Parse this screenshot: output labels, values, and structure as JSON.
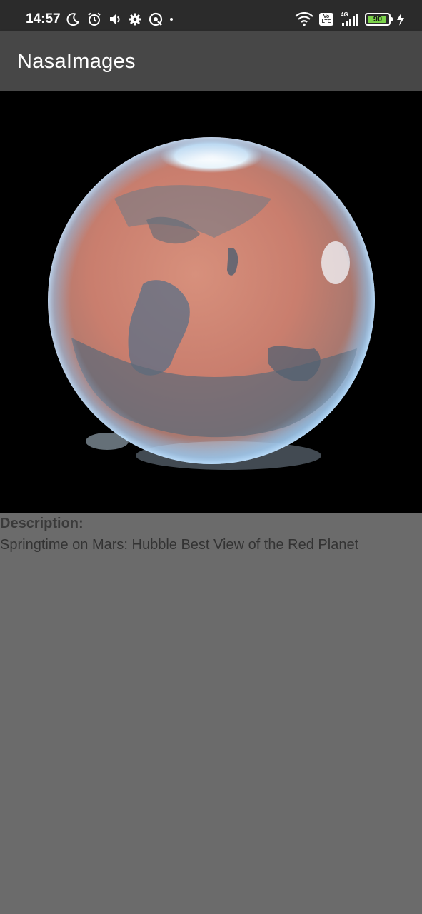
{
  "status_bar": {
    "time": "14:57",
    "left_icons": [
      "moon-icon",
      "alarm-icon",
      "volume-icon",
      "settings-icon",
      "hotspot-icon"
    ],
    "right_icons": [
      "wifi-icon",
      "volte-icon",
      "signal-icon",
      "battery-icon",
      "charging-icon"
    ],
    "volte_label": "Vo LTE",
    "network_type": "4G",
    "battery_level": "90",
    "battery_color": "#7bd24a"
  },
  "app_bar": {
    "title": "NasaImages",
    "background": "#474747"
  },
  "image": {
    "subject": "mars-planet-image"
  },
  "description": {
    "heading": "Description:",
    "text": "Springtime on Mars: Hubble Best View of the Red Planet"
  },
  "colors": {
    "status_bar": "#2b2b2b",
    "page_background": "#6b6b6b"
  }
}
